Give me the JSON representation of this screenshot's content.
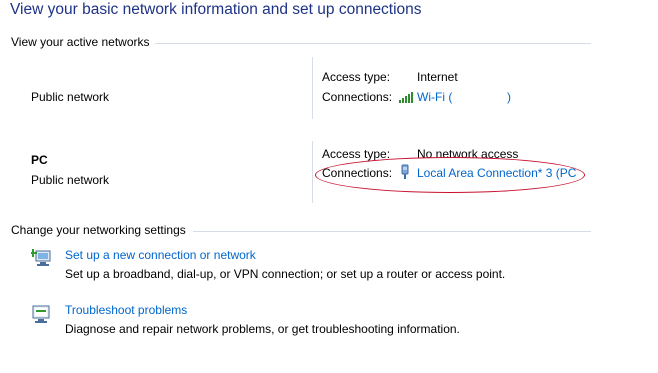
{
  "page": {
    "title": "View your basic network information and set up connections"
  },
  "active_networks": {
    "section_label": "View your active networks",
    "networks": [
      {
        "name": "",
        "category": "Public network",
        "access_type_label": "Access type:",
        "access_type_value": "Internet",
        "connections_label": "Connections:",
        "connection_icon": "wifi-signal-icon",
        "connection_link": "Wi-Fi (",
        "connection_link_close": ")"
      },
      {
        "name": "PC",
        "category": "Public network",
        "access_type_label": "Access type:",
        "access_type_value": "No network access",
        "connections_label": "Connections:",
        "connection_icon": "ethernet-adapter-icon",
        "connection_link": "Local Area Connection* 3 (PC"
      }
    ]
  },
  "networking_settings": {
    "section_label": "Change your networking settings",
    "tasks": [
      {
        "icon": "new-connection-icon",
        "link": "Set up a new connection or network",
        "description": "Set up a broadband, dial-up, or VPN connection; or set up a router or access point."
      },
      {
        "icon": "troubleshoot-icon",
        "link": "Troubleshoot problems",
        "description": "Diagnose and repair network problems, or get troubleshooting information."
      }
    ]
  },
  "colors": {
    "title": "#1e3287",
    "link": "#0066cc",
    "annotation_ellipse": "#c8102e"
  }
}
